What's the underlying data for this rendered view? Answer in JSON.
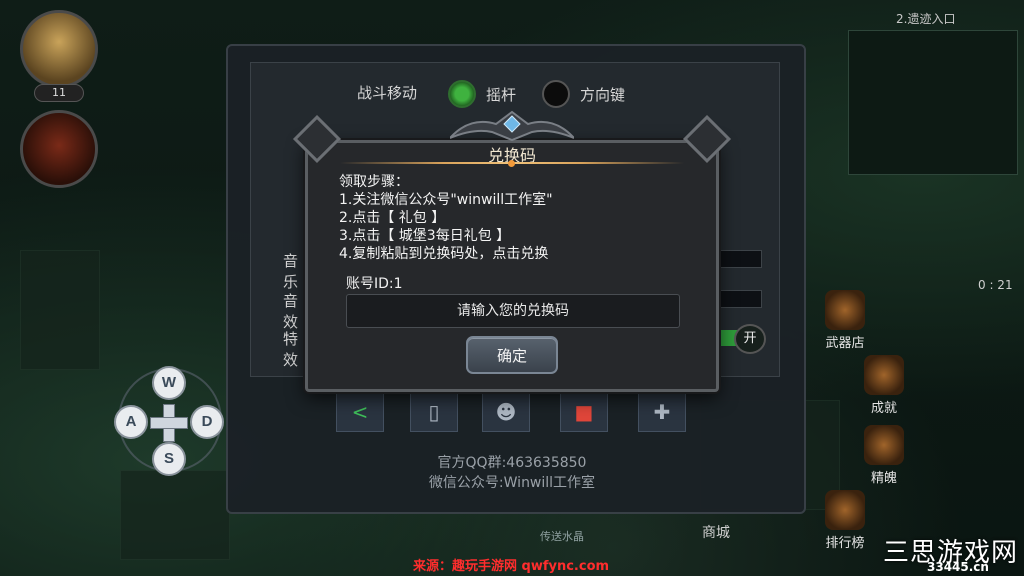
{
  "hud": {
    "level": "11",
    "minimap_title": "2.遗迹入口",
    "timer": "0 : 21",
    "side_buttons": [
      "武器店",
      "成就",
      "精魄",
      "排行榜"
    ],
    "shop_label": "商城",
    "map_label": "传送水晶"
  },
  "settings": {
    "combat_move_label": "战斗移动",
    "option_joystick": "摇杆",
    "option_arrows": "方向键",
    "selected_option": "摇杆",
    "row_label_music": "音乐",
    "row_label_sfx": "音效",
    "row_label_effects": "特效",
    "toggle_label": "开",
    "qq_group": "官方QQ群:463635850",
    "wechat": "微信公众号:Winwill工作室"
  },
  "joystick": {
    "up": "W",
    "left": "A",
    "right": "D",
    "down": "S"
  },
  "modal": {
    "title": "兑换码",
    "steps_heading": "领取步骤：",
    "steps": [
      "1.关注微信公众号\"winwill工作室\"",
      "2.点击【 礼包 】",
      "3.点击【 城堡3每日礼包 】",
      "4.复制粘贴到兑换码处，点击兑换"
    ],
    "account": "账号ID:1",
    "input_placeholder": "请输入您的兑换码",
    "confirm_label": "确定"
  },
  "watermark": {
    "source": "来源：趣玩手游网 qwfync.com",
    "site_name": "三思游戏网",
    "site_url": "33445.cn"
  },
  "colors": {
    "accent_gold": "#f0c27a",
    "radio_on": "#3fb23f",
    "watermark_red": "#ff2d2d"
  }
}
